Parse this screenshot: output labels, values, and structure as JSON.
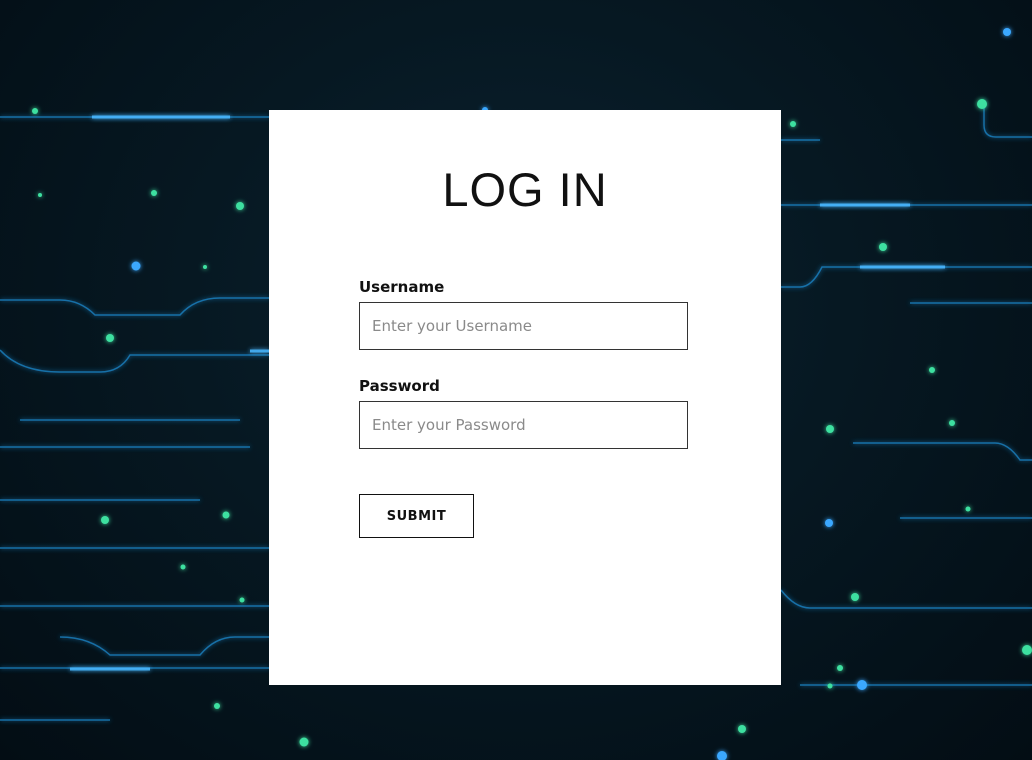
{
  "theme": {
    "background": "#061822",
    "circuit_line": "#1e8fd6",
    "node_green": "#3ee0a0",
    "node_blue": "#3aa8ff",
    "card": "#ffffff",
    "text": "#111111"
  },
  "login": {
    "title": "LOG IN",
    "username": {
      "label": "Username",
      "placeholder": "Enter your Username",
      "value": ""
    },
    "password": {
      "label": "Password",
      "placeholder": "Enter your Password",
      "value": ""
    },
    "submit_label": "SUBMIT"
  }
}
